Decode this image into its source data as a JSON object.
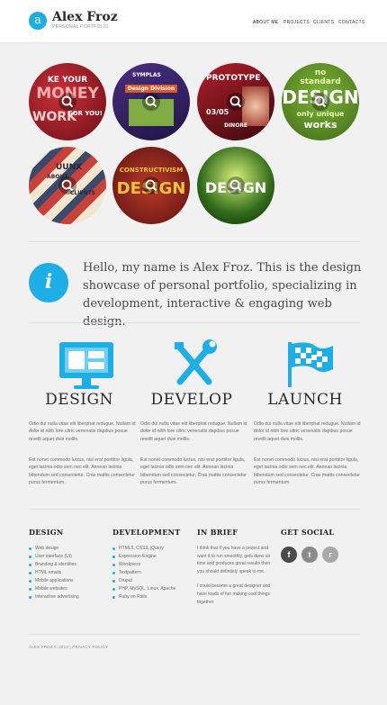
{
  "header": {
    "logo_letter": "a",
    "name": "Alex Froz",
    "tagline": "Personal portfolio",
    "nav": [
      "About me",
      "Projects",
      "Clients",
      "Contacts"
    ]
  },
  "gallery": {
    "thumbs": [
      {
        "caption_1": "KE YOUR",
        "caption_2": "MONEY",
        "caption_3": "WORK",
        "caption_4": "FOR YOU!"
      },
      {
        "caption_1": "SYMPLAS",
        "caption_2": "Design Division"
      },
      {
        "caption_1": "PROTOTYPE",
        "caption_2": "03/05",
        "caption_3": "DINORE"
      },
      {
        "caption_1": "no",
        "caption_2": "standard",
        "caption_3": "DESIGN",
        "caption_4": "only unique",
        "caption_5": "works"
      },
      {
        "caption_1": "UUNX",
        "caption_2": "ABOUT",
        "caption_3": "CLIENTS"
      },
      {
        "caption_1": "CONSTRUCTIVISM",
        "caption_2": "DESIGN"
      },
      {
        "caption_1": "DESIGN"
      }
    ]
  },
  "intro": {
    "text": "Hello, my name is Alex Froz. This  is the design showcase of personal portfolio,  specializing in development, interactive & engaging web design."
  },
  "features": [
    {
      "icon": "monitor-icon",
      "title": "DESIGN",
      "p1": "Odio dui nulla vitae elit liberphat redugue. Nullam id dolor id nibh lore ultric venenatis dapibus posue revellt aquet duis mollis.",
      "p2": "Est nonet commodo luctus, nisi erat porttitor ligula, eget lacinia odio sem nec elit. Aenean lacinia bibendum sed consectetur. Cras mattis consectetur purus fermentum."
    },
    {
      "icon": "tools-icon",
      "title": "DEVELOP",
      "p1": "Odio dui nulla vitae elit liberphat redugue. Nullam id dolor id nibh lore ultric venenatis dapibus posue revellt aquet duis mollis.",
      "p2": "Est nonet commodo luctus, nisi erat porttitor ligula, eget lacinia odio sem nec elit. Aenean lacinia bibendum sed consectetur. Cras mattis consectetur purus fermentum."
    },
    {
      "icon": "flag-icon",
      "title": "LAUNCH",
      "p1": "Odio dui nulla vitae elit liberphat redugue. Nullam id dolor id nibh lore ultric venenatis dapibus posue revellt aquet duis mollis.",
      "p2": "Est nonet commodo luctus, nisi erat porttitor ligula, eget lacinia odio sem nec elit. Aenean lacinia bibendum sed consectetur. Cras mattis consectetur purus fermentum."
    }
  ],
  "footer": {
    "design": {
      "title": "DESIGN",
      "items": [
        "Web design",
        "User interface (UI)",
        "Branding & identities",
        "HTML emails",
        "Mobile applications",
        "Mobile websites",
        "Interactive advertising"
      ]
    },
    "development": {
      "title": "DEVELOPMENT",
      "items": [
        "HTML5, CSS3, jQuery",
        "Expression Engine",
        "Wordpress",
        "Textpattern",
        "Drupal",
        "PHP, MySQL, Linux, Apache",
        "Ruby on Rails"
      ]
    },
    "brief": {
      "title": "IN BRIEF",
      "p1": "I think that if you have a project and want it to run smoothly, gets done on time and produces great results then you should definitely speak to me.",
      "p2": "I could become a great designer and have loads of fun making cool things together."
    },
    "social": {
      "title": "GET SOCIAL",
      "facebook": "f",
      "twitter": "t",
      "rss": "r"
    },
    "copyright": "Alex Froz © 2012 | Privacy Policy"
  },
  "colors": {
    "accent": "#1daee6"
  }
}
